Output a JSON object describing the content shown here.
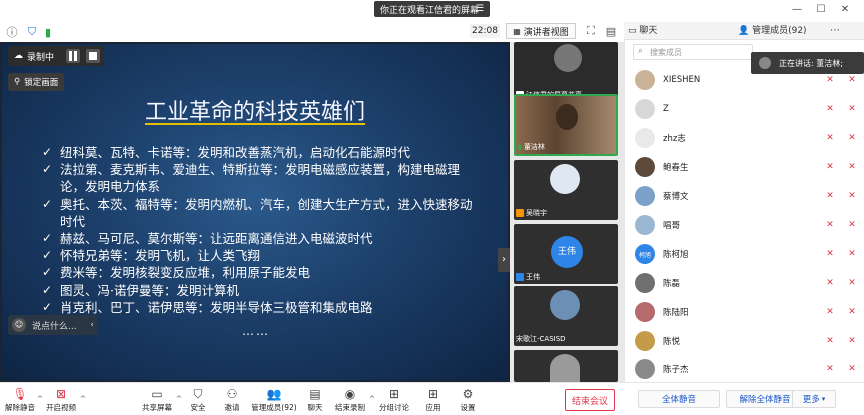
{
  "top": {
    "share_banner": "你正在观看江信君的屏幕",
    "timer": "22:08",
    "view_button": "演讲者视图",
    "tab_chat": "聊天",
    "tab_members": "管理成员(92)"
  },
  "stage": {
    "recording": "录制中",
    "lock": "锁定画面",
    "chat_placeholder": "说点什么...",
    "slide_title": "工业革命的科技英雄们",
    "bullets": [
      "纽科莫、瓦特、卡诺等：发明和改善蒸汽机，启动化石能源时代",
      "法拉第、麦克斯韦、爱迪生、特斯拉等：发明电磁感应装置，构建电磁理论，发明电力体系",
      "奥托、本茨、福特等：发明内燃机、汽车，创建大生产方式，进入快速移动时代",
      "赫兹、马可尼、莫尔斯等：让远距离通信进入电磁波时代",
      "怀特兄弟等：发明飞机，让人类飞翔",
      "费米等：发明核裂变反应堆，利用原子能发电",
      "图灵、冯·诺伊曼等：发明计算机",
      "肖克利、巴丁、诺伊思等：发明半导体三极管和集成电路"
    ],
    "dots": "……"
  },
  "strip": {
    "tiles": [
      {
        "label": "江信君的屏幕共享"
      },
      {
        "label": "董洁林"
      },
      {
        "label": "吴晓宇"
      },
      {
        "label": "王伟",
        "avatar": "王伟"
      },
      {
        "label": "宋歌江-CASISD"
      },
      {
        "label": ""
      }
    ]
  },
  "panel": {
    "search_placeholder": "搜索成员",
    "speaking": "正在讲话: 董洁林;",
    "members": [
      {
        "name": "XIESHEN",
        "avatar": ""
      },
      {
        "name": "Z",
        "avatar": ""
      },
      {
        "name": "zhz志",
        "avatar": ""
      },
      {
        "name": "鲍春生",
        "avatar": ""
      },
      {
        "name": "蔡博文",
        "avatar": ""
      },
      {
        "name": "唱哥",
        "avatar": ""
      },
      {
        "name": "陈柯旭",
        "avatar": "柯旭"
      },
      {
        "name": "陈磊",
        "avatar": ""
      },
      {
        "name": "陈陆阳",
        "avatar": ""
      },
      {
        "name": "陈悦",
        "avatar": ""
      },
      {
        "name": "陈子杰",
        "avatar": ""
      }
    ],
    "mute_all": "全体静音",
    "unmute_all": "解除全体静音",
    "more": "更多"
  },
  "toolbar": {
    "items": [
      "解除静音",
      "开启视频",
      "共享屏幕",
      "安全",
      "邀请",
      "管理成员(92)",
      "聊天",
      "结束录制",
      "分组讨论",
      "应用",
      "设置"
    ],
    "end": "结束会议"
  },
  "colors": {
    "accent_red": "#e0374a",
    "blue": "#2f84e8"
  }
}
